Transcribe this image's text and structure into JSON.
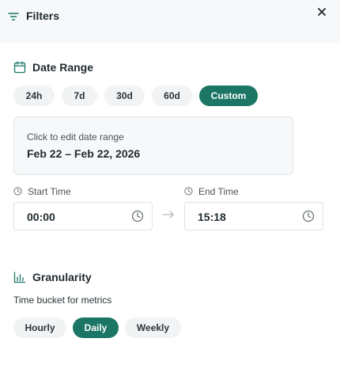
{
  "header": {
    "title": "Filters",
    "close_symbol": "✕"
  },
  "date_range": {
    "title": "Date Range",
    "presets": [
      {
        "label": "24h",
        "active": false
      },
      {
        "label": "7d",
        "active": false
      },
      {
        "label": "30d",
        "active": false
      },
      {
        "label": "60d",
        "active": false
      },
      {
        "label": "Custom",
        "active": true
      }
    ],
    "card_hint": "Click to edit date range",
    "card_value": "Feb 22 – Feb 22, 2026"
  },
  "start_time": {
    "label": "Start Time",
    "value": "00:00"
  },
  "end_time": {
    "label": "End Time",
    "value": "15:18"
  },
  "granularity": {
    "title": "Granularity",
    "subtitle": "Time bucket for metrics",
    "options": [
      {
        "label": "Hourly",
        "active": false
      },
      {
        "label": "Daily",
        "active": true
      },
      {
        "label": "Weekly",
        "active": false
      }
    ]
  },
  "colors": {
    "accent": "#1b7665",
    "pill_bg": "#f1f3f4",
    "header_bg": "#f7f8f9"
  }
}
